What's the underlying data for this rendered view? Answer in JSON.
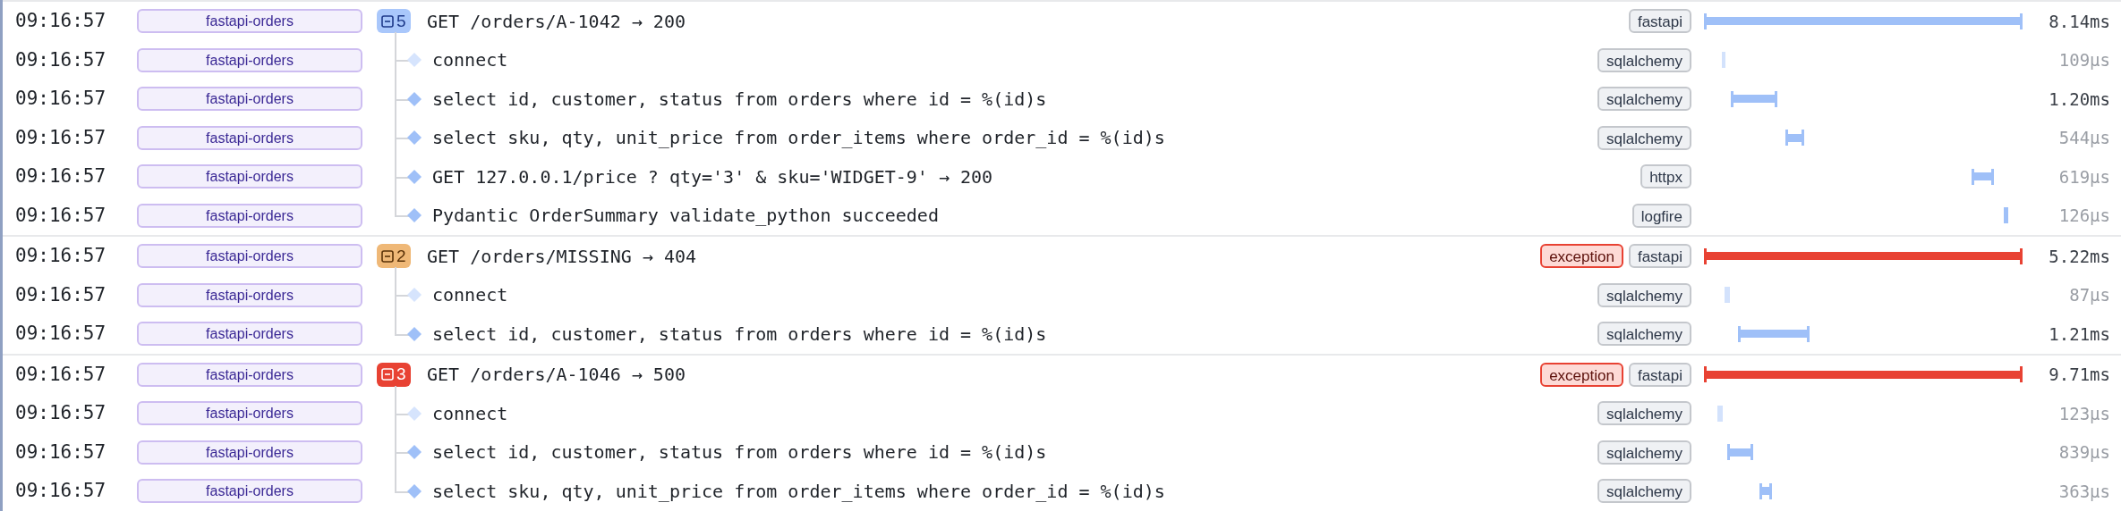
{
  "traces": [
    {
      "root": {
        "time": "09:16:57",
        "service": "fastapi-orders",
        "count": "5",
        "color": "#a9c7fb",
        "message": "GET /orders/A-1042 → 200",
        "tags": [
          {
            "text": "fastapi",
            "kind": "library"
          }
        ],
        "duration": "8.14ms"
      },
      "children": [
        {
          "time": "09:16:57",
          "service": "fastapi-orders",
          "message": "connect",
          "dim": true,
          "tags": [
            {
              "text": "sqlalchemy",
              "kind": "library"
            }
          ],
          "duration": "109µs",
          "emphasized": false
        },
        {
          "time": "09:16:57",
          "service": "fastapi-orders",
          "message": "select id, customer, status from orders where id = %(id)s",
          "dim": false,
          "tags": [
            {
              "text": "sqlalchemy",
              "kind": "library"
            }
          ],
          "duration": "1.20ms",
          "emphasized": true
        },
        {
          "time": "09:16:57",
          "service": "fastapi-orders",
          "message": "select sku, qty, unit_price from order_items where order_id = %(id)s",
          "dim": false,
          "tags": [
            {
              "text": "sqlalchemy",
              "kind": "library"
            }
          ],
          "duration": "544µs",
          "emphasized": false
        },
        {
          "time": "09:16:57",
          "service": "fastapi-orders",
          "message": "GET 127.0.0.1/price ? qty='3' & sku='WIDGET-9' → 200",
          "dim": false,
          "tags": [
            {
              "text": "httpx",
              "kind": "library"
            }
          ],
          "duration": "619µs",
          "emphasized": false
        },
        {
          "time": "09:16:57",
          "service": "fastapi-orders",
          "message": "Pydantic OrderSummary validate_python succeeded",
          "dim": false,
          "tags": [
            {
              "text": "logfire",
              "kind": "library"
            }
          ],
          "duration": "126µs",
          "emphasized": false
        }
      ]
    },
    {
      "root": {
        "time": "09:16:57",
        "service": "fastapi-orders",
        "count": "2",
        "color": "#efb877",
        "message": "GET /orders/MISSING → 404",
        "tags": [
          {
            "text": "exception",
            "kind": "exception"
          },
          {
            "text": "fastapi",
            "kind": "library"
          }
        ],
        "duration": "5.22ms"
      },
      "children": [
        {
          "time": "09:16:57",
          "service": "fastapi-orders",
          "message": "connect",
          "dim": true,
          "tags": [
            {
              "text": "sqlalchemy",
              "kind": "library"
            }
          ],
          "duration": "87µs",
          "emphasized": false
        },
        {
          "time": "09:16:57",
          "service": "fastapi-orders",
          "message": "select id, customer, status from orders where id = %(id)s",
          "dim": false,
          "tags": [
            {
              "text": "sqlalchemy",
              "kind": "library"
            }
          ],
          "duration": "1.21ms",
          "emphasized": true
        }
      ]
    },
    {
      "root": {
        "time": "09:16:57",
        "service": "fastapi-orders",
        "count": "3",
        "color": "#e84233",
        "message": "GET /orders/A-1046 → 500",
        "tags": [
          {
            "text": "exception",
            "kind": "exception"
          },
          {
            "text": "fastapi",
            "kind": "library"
          }
        ],
        "duration": "9.71ms"
      },
      "children": [
        {
          "time": "09:16:57",
          "service": "fastapi-orders",
          "message": "connect",
          "dim": true,
          "tags": [
            {
              "text": "sqlalchemy",
              "kind": "library"
            }
          ],
          "duration": "123µs",
          "emphasized": false
        },
        {
          "time": "09:16:57",
          "service": "fastapi-orders",
          "message": "select id, customer, status from orders where id = %(id)s",
          "dim": false,
          "tags": [
            {
              "text": "sqlalchemy",
              "kind": "library"
            }
          ],
          "duration": "839µs",
          "emphasized": false
        },
        {
          "time": "09:16:57",
          "service": "fastapi-orders",
          "message": "select sku, qty, unit_price from order_items where order_id = %(id)s",
          "dim": false,
          "tags": [
            {
              "text": "sqlalchemy",
              "kind": "library"
            }
          ],
          "duration": "363µs",
          "emphasized": false
        }
      ]
    }
  ]
}
